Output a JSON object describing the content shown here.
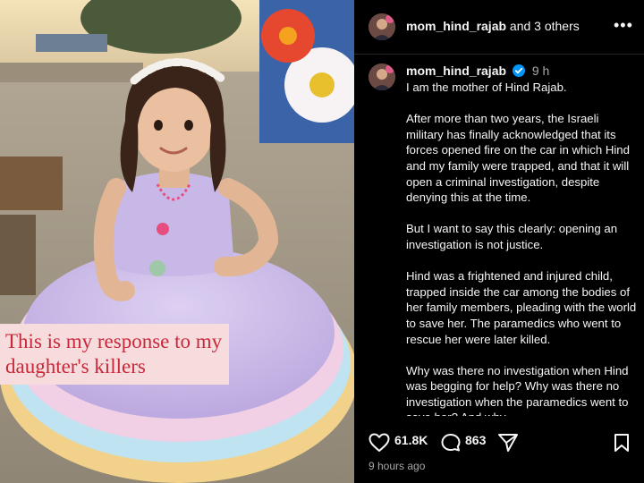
{
  "photo": {
    "caption_lines": [
      "This is my response to my",
      "daughter's killers"
    ]
  },
  "header": {
    "username": "mom_hind_rajab",
    "others": "and 3 others",
    "more_icon": "more-horizontal-icon"
  },
  "post": {
    "username": "mom_hind_rajab",
    "time": "9 h",
    "paragraphs": [
      "I am the mother of Hind Rajab.",
      "After more than two years, the Israeli military has finally acknowledged that its forces opened fire on the car in which Hind and my family were trapped, and that it will open a criminal investigation, despite denying this at the time.",
      "But I want to say this clearly: opening an investigation is not justice.",
      "Hind was a frightened and injured child, trapped inside the car among the bodies of her family members, pleading with the world to save her. The paramedics who went to rescue her were later killed.",
      "Why was there no investigation when Hind was begging for help? Why was there no investigation when the paramedics went to save her? And why,"
    ]
  },
  "actions": {
    "likes": "61.8K",
    "comments": "863",
    "posted_ago": "9 hours ago"
  },
  "colors": {
    "verified": "#0095f6",
    "caption_text": "#c8283a",
    "caption_bg": "#f6dcdd",
    "secondary_text": "#a8a8a8"
  }
}
